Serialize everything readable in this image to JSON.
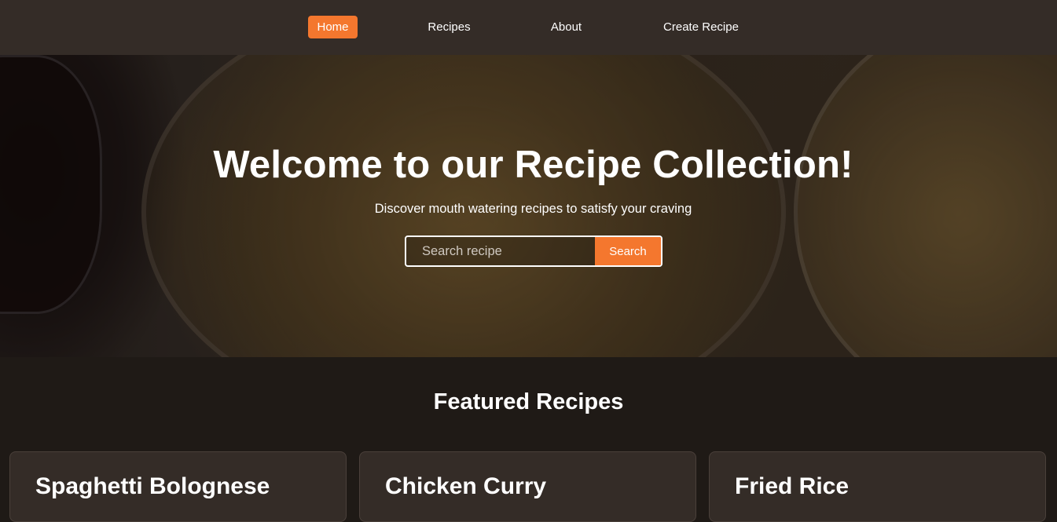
{
  "nav": {
    "items": [
      {
        "label": "Home",
        "active": true
      },
      {
        "label": "Recipes",
        "active": false
      },
      {
        "label": "About",
        "active": false
      },
      {
        "label": "Create Recipe",
        "active": false
      }
    ]
  },
  "hero": {
    "title": "Welcome to our Recipe Collection!",
    "subtitle": "Discover mouth watering recipes to satisfy your craving",
    "search": {
      "placeholder": "Search recipe",
      "value": "",
      "button_label": "Search"
    }
  },
  "featured": {
    "title": "Featured Recipes",
    "cards": [
      {
        "title": "Spaghetti Bolognese"
      },
      {
        "title": "Chicken Curry"
      },
      {
        "title": "Fried Rice"
      }
    ]
  },
  "colors": {
    "accent": "#f4772e",
    "nav_bg": "#342c27",
    "page_bg": "#1f1a16",
    "card_bg": "#342c27"
  }
}
